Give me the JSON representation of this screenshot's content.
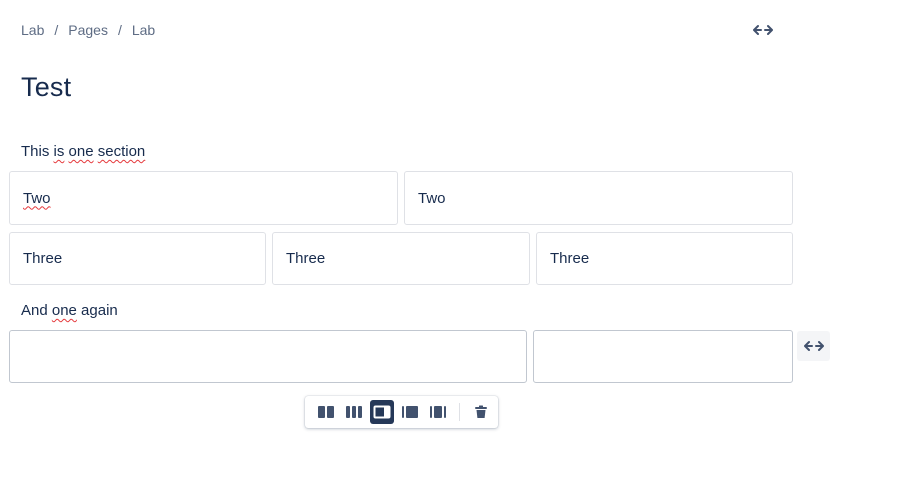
{
  "breadcrumb": {
    "items": [
      "Lab",
      "Pages",
      "Lab"
    ],
    "separator": "/"
  },
  "page": {
    "title": "Test"
  },
  "content": {
    "para1": {
      "parts": [
        "This ",
        "is",
        " ",
        "one",
        " ",
        "section"
      ]
    },
    "row_two": [
      "Two",
      "Two"
    ],
    "row_three": [
      "Three",
      "Three",
      "Three"
    ],
    "para2": {
      "parts": [
        "And ",
        "one",
        " again"
      ]
    },
    "row_empty": [
      "",
      ""
    ]
  },
  "toolbar": {
    "buttons": [
      {
        "icon": "two-columns-icon",
        "selected": false
      },
      {
        "icon": "three-columns-icon",
        "selected": false
      },
      {
        "icon": "right-sidebar-icon",
        "selected": true
      },
      {
        "icon": "left-sidebar-icon",
        "selected": false
      },
      {
        "icon": "three-columns-with-sidebars-icon",
        "selected": false
      }
    ],
    "delete_icon": "trash-icon"
  },
  "icons": {
    "width_toggle": "expand-horizontal-icon"
  },
  "colors": {
    "text": "#172b4d",
    "muted": "#5e6c84",
    "border": "#dfe1e6",
    "icon": "#42526e",
    "selected": "#253858",
    "spellcheck": "#e5383b"
  }
}
